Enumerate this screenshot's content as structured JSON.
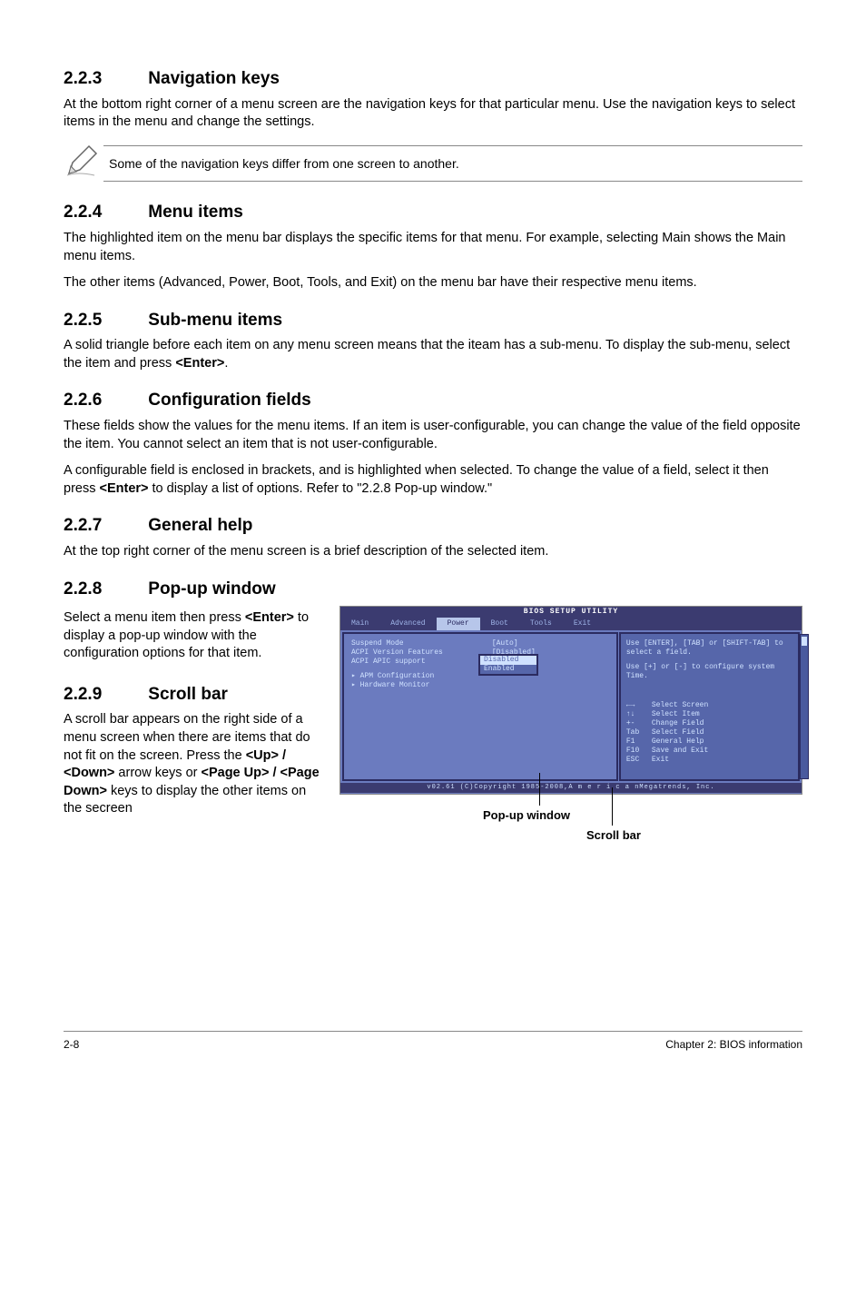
{
  "s223": {
    "num": "2.2.3",
    "title": "Navigation keys",
    "p1": "At the bottom right corner of a menu screen are the navigation keys for that particular menu. Use the navigation keys to select items in the menu and change the settings."
  },
  "note1": "Some of the navigation keys differ from one screen to another.",
  "s224": {
    "num": "2.2.4",
    "title": "Menu items",
    "p1": "The highlighted item on the menu bar  displays the specific items for that menu. For example, selecting Main shows the Main menu items.",
    "p2": "The other items (Advanced, Power, Boot, Tools, and Exit) on the menu bar have their respective menu items."
  },
  "s225": {
    "num": "2.2.5",
    "title": "Sub-menu items",
    "p1_a": "A solid triangle before each item on any menu screen means that the iteam has a sub-menu. To display the sub-menu, select the item and press ",
    "p1_b": "<Enter>",
    "p1_c": "."
  },
  "s226": {
    "num": "2.2.6",
    "title": "Configuration fields",
    "p1": "These fields show the values for the menu items. If an item is user-configurable, you can change the value of the field opposite the item. You cannot select an item that is not user-configurable.",
    "p2_a": "A configurable field is enclosed in brackets, and is highlighted when selected. To change the value of a field, select it then press ",
    "p2_b": "<Enter>",
    "p2_c": " to display a list of options. Refer to \"2.2.8 Pop-up window.\""
  },
  "s227": {
    "num": "2.2.7",
    "title": "General help",
    "p1": "At the top right corner of the menu screen is a brief description of the selected item."
  },
  "s228": {
    "num": "2.2.8",
    "title": "Pop-up window",
    "p1_a": "Select a menu item then press ",
    "p1_b": "<Enter>",
    "p1_c": " to display a pop-up window with the configuration options for that item."
  },
  "s229": {
    "num": "2.2.9",
    "title": "Scroll bar",
    "p1_a": "A scroll bar appears on the right side of a menu screen when there are items that do not fit on the screen. Press the ",
    "p1_b": "<Up> / <Down>",
    "p1_c": " arrow keys or ",
    "p1_d": "<Page Up> / <Page Down>",
    "p1_e": " keys to display the other items on the secreen"
  },
  "bios": {
    "title": "BIOS SETUP UTILITY",
    "tabs": [
      "Main",
      "Advanced",
      "Power",
      "Boot",
      "Tools",
      "Exit"
    ],
    "rows": [
      {
        "label": "Suspend Mode",
        "val": "[Auto]"
      },
      {
        "label": "ACPI Version Features",
        "val": "[Disabled]"
      },
      {
        "label": "ACPI APIC support",
        "val": ""
      }
    ],
    "popup": {
      "opt1": "Disabled",
      "opt2": "Enabled"
    },
    "subs": [
      "APM Configuration",
      "Hardware Monitor"
    ],
    "help1": "Use [ENTER], [TAB] or [SHIFT-TAB] to select a field.",
    "help2": "Use [+] or [-] to configure system Time.",
    "keys": [
      {
        "k": "←→",
        "d": "Select Screen"
      },
      {
        "k": "↑↓",
        "d": "Select Item"
      },
      {
        "k": "+-",
        "d": "Change Field"
      },
      {
        "k": "Tab",
        "d": "Select Field"
      },
      {
        "k": "F1",
        "d": "General Help"
      },
      {
        "k": "F10",
        "d": "Save and Exit"
      },
      {
        "k": "ESC",
        "d": "Exit"
      }
    ],
    "copy": "v02.61 (C)Copyright 1985-2008,A m e r i c a nMegatrends, Inc."
  },
  "fig": {
    "popup": "Pop-up window",
    "scroll": "Scroll bar"
  },
  "footer": {
    "left": "2-8",
    "right": "Chapter 2: BIOS information"
  }
}
